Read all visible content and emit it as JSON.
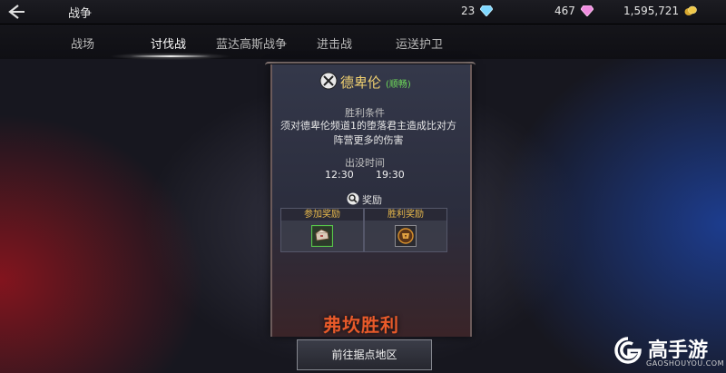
{
  "header": {
    "title": "战争",
    "currencies": [
      {
        "value": "23",
        "icon": "diamond-icon",
        "color": "#7fd8ff"
      },
      {
        "value": "467",
        "icon": "pink-diamond-icon",
        "color": "#f08ce0"
      },
      {
        "value": "1,595,721",
        "icon": "gold-coin-icon",
        "color": "#e8c040"
      }
    ]
  },
  "tabs": [
    {
      "label": "战场",
      "active": false
    },
    {
      "label": "讨伐战",
      "active": true
    },
    {
      "label": "蓝达高斯战争",
      "active": false
    },
    {
      "label": "进击战",
      "active": false
    },
    {
      "label": "运送护卫",
      "active": false
    }
  ],
  "panel": {
    "boss_name": "德卑伦",
    "boss_status": "(顺畅)",
    "victory_title": "胜利条件",
    "victory_desc": "须对德卑伦频道1的堕落君主造成比对方阵营更多的伤害",
    "spawn_title": "出没时间",
    "spawn_times": [
      "12:30",
      "19:30"
    ],
    "rewards_title": "奖励",
    "reward_columns": [
      {
        "label": "参加奖励",
        "icon": "box-icon"
      },
      {
        "label": "胜利奖励",
        "icon": "chest-icon"
      }
    ],
    "result": "弗坎胜利",
    "go_button": "前往据点地区"
  },
  "watermark": {
    "name": "高手游",
    "url": "GAOSHOUYOU.COM"
  }
}
